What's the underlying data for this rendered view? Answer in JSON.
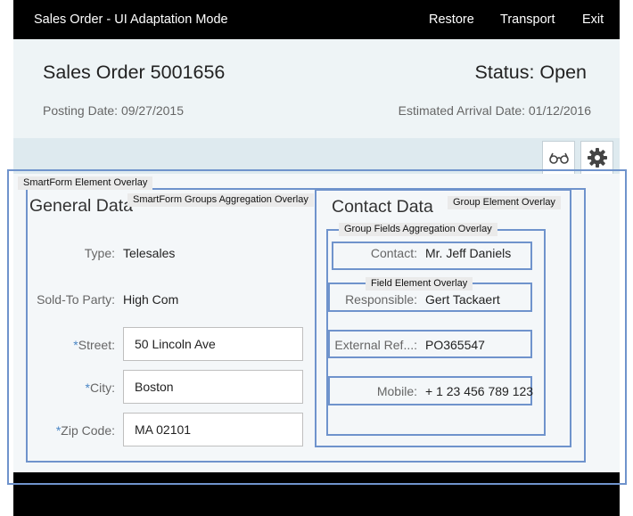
{
  "topbar": {
    "title": "Sales Order - UI Adaptation Mode",
    "restore_label": "Restore",
    "transport_label": "Transport",
    "exit_label": "Exit"
  },
  "header": {
    "title": "Sales Order 5001656",
    "status": "Status: Open",
    "posting_date": "Posting Date: 09/27/2015",
    "arrival_date": "Estimated Arrival Date: 01/12/2016"
  },
  "toolbar": {
    "icons": [
      "glasses-icon",
      "gear-icon"
    ]
  },
  "overlays": {
    "smartform_element": "SmartForm Element Overlay",
    "groups_aggregation": "SmartForm Groups Aggregation Overlay",
    "group_element": "Group Element Overlay",
    "group_fields_aggregation": "Group Fields Aggregation Overlay",
    "field_element": "Field Element Overlay"
  },
  "general_data": {
    "title": "General Data",
    "type_label": "Type:",
    "type_value": "Telesales",
    "sold_to_label": "Sold-To Party:",
    "sold_to_value": "High Com",
    "street_label": "Street:",
    "street_value": "50 Lincoln Ave",
    "city_label": "City:",
    "city_value": "Boston",
    "zip_label": "Zip Code:",
    "zip_value": "MA 02101",
    "required_marker": "*"
  },
  "contact_data": {
    "title": "Contact Data",
    "contact_label": "Contact:",
    "contact_value": "Mr. Jeff Daniels",
    "responsible_label": "Responsible:",
    "responsible_value": "Gert Tackaert",
    "external_ref_label": "External Ref...:",
    "external_ref_value": "PO365547",
    "mobile_label": "Mobile:",
    "mobile_value": "+ 1 23 456 789 123"
  },
  "colors": {
    "overlay_border": "#6f93cc",
    "required": "#4a86c5",
    "bar": "#000000"
  }
}
